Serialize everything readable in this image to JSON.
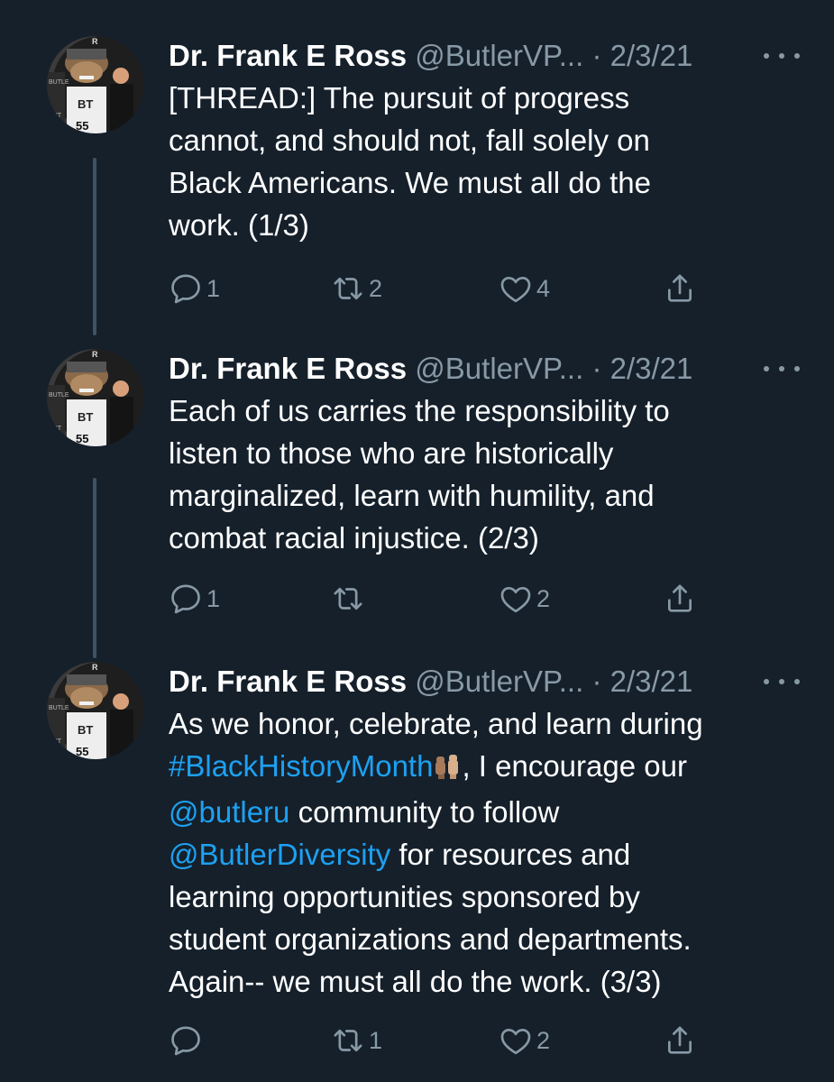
{
  "tweets": [
    {
      "name": "Dr. Frank E Ross",
      "handle": "@ButlerVP...",
      "separator": "·",
      "date": "2/3/21",
      "lines": [
        "[THREAD:] The pursuit of progress",
        "cannot, and should not, fall solely on",
        "Black Americans. We must all do the",
        "work. (1/3)"
      ],
      "replies": "1",
      "retweets": "2",
      "likes": "4"
    },
    {
      "name": "Dr. Frank E Ross",
      "handle": "@ButlerVP...",
      "separator": "·",
      "date": "2/3/21",
      "lines": [
        "Each of us carries the responsibility to",
        "listen to those who are historically",
        "marginalized, learn with humility, and",
        "combat racial injustice. (2/3)"
      ],
      "replies": "1",
      "retweets": "",
      "likes": "2"
    },
    {
      "name": "Dr. Frank E Ross",
      "handle": "@ButlerVP...",
      "separator": "·",
      "date": "2/3/21",
      "line1": "As we honor, celebrate, and learn during",
      "hashtag": "#BlackHistoryMonth",
      "emoji_icon": "raised-fists-emoji",
      "after_hashtag": ", I encourage our",
      "mention1": "@butleru",
      "after_mention1": " community to follow",
      "mention2": "@ButlerDiversity",
      "after_mention2": " for resources and",
      "line5": "learning opportunities sponsored by",
      "line6": "student organizations and departments.",
      "line7": "Again-- we must all do the work. (3/3)",
      "replies": "",
      "retweets": "1",
      "likes": "2"
    }
  ],
  "colors": {
    "background": "#15202b",
    "secondary_text": "#8899a6",
    "link": "#1da1f2",
    "thread_line": "#3d5466"
  },
  "icons": {
    "reply": "reply-icon",
    "retweet": "retweet-icon",
    "like": "heart-icon",
    "share": "share-icon",
    "more": "more-icon"
  }
}
